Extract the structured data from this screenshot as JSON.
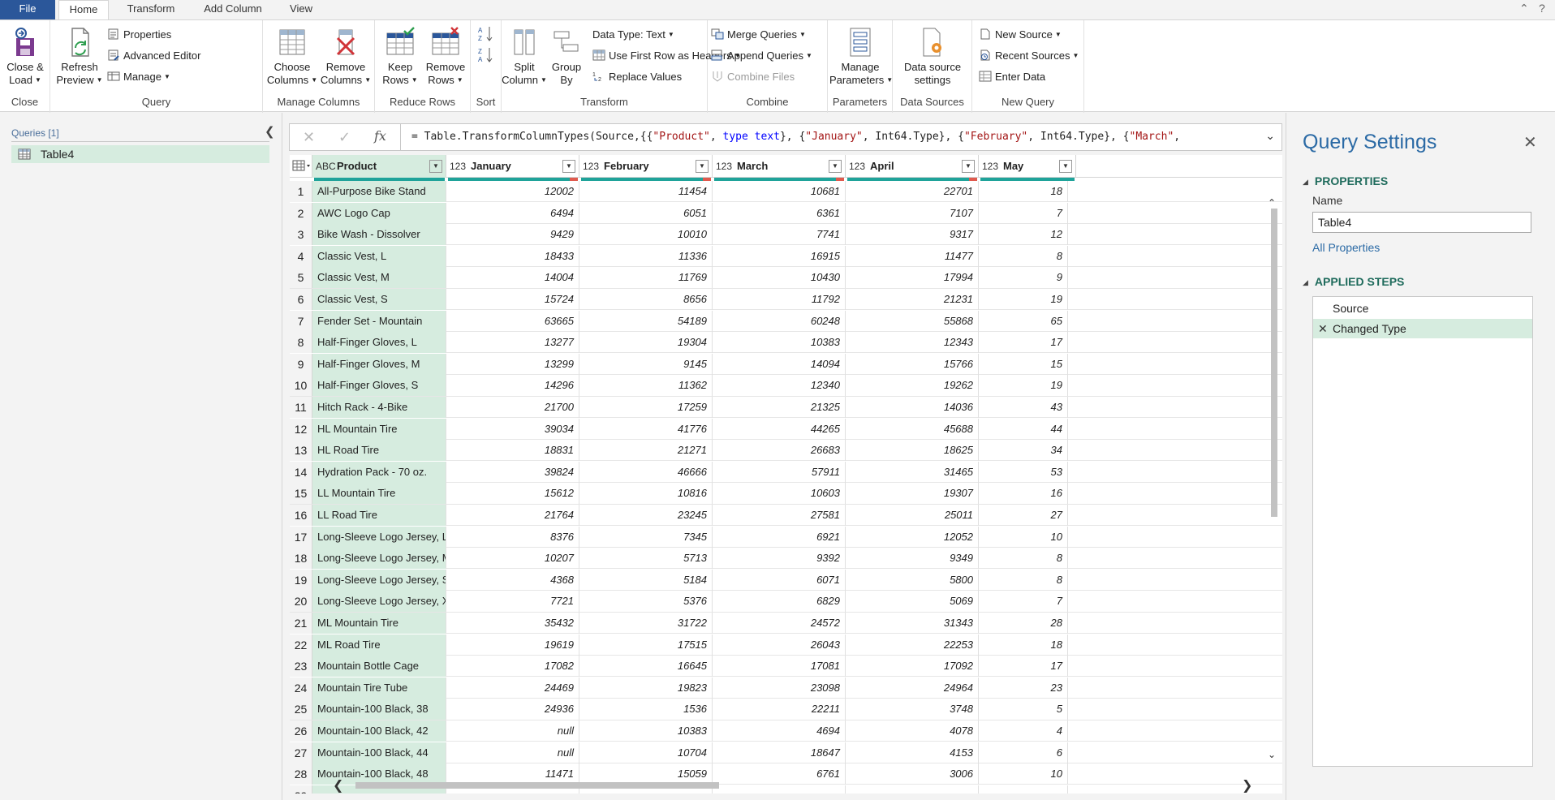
{
  "tabs": {
    "file": "File",
    "home": "Home",
    "transform": "Transform",
    "add_column": "Add Column",
    "view": "View"
  },
  "ribbon": {
    "close_load": [
      "Close &",
      "Load"
    ],
    "refresh": [
      "Refresh",
      "Preview"
    ],
    "properties": "Properties",
    "advanced_editor": "Advanced Editor",
    "manage": "Manage",
    "choose_columns": [
      "Choose",
      "Columns"
    ],
    "remove_columns": [
      "Remove",
      "Columns"
    ],
    "keep_rows": [
      "Keep",
      "Rows"
    ],
    "remove_rows": [
      "Remove",
      "Rows"
    ],
    "split_column": [
      "Split",
      "Column"
    ],
    "group_by": [
      "Group",
      "By"
    ],
    "data_type": "Data Type: Text",
    "use_first_row": "Use First Row as Headers",
    "replace_values": "Replace Values",
    "merge_queries": "Merge Queries",
    "append_queries": "Append Queries",
    "combine_files": "Combine Files",
    "manage_parameters": [
      "Manage",
      "Parameters"
    ],
    "data_source_settings": [
      "Data source",
      "settings"
    ],
    "new_source": "New Source",
    "recent_sources": "Recent Sources",
    "enter_data": "Enter Data",
    "groups": {
      "close": "Close",
      "query": "Query",
      "manage_columns": "Manage Columns",
      "reduce_rows": "Reduce Rows",
      "sort": "Sort",
      "transform": "Transform",
      "combine": "Combine",
      "parameters": "Parameters",
      "data_sources": "Data Sources",
      "new_query": "New Query"
    }
  },
  "queries": {
    "header": "Queries [1]",
    "items": [
      "Table4"
    ]
  },
  "formula": {
    "prefix": "= Table.TransformColumnTypes(Source,{{",
    "s1": "\"Product\"",
    "c1": ", ",
    "k1": "type text",
    "c2": "}, {",
    "s2": "\"January\"",
    "c3": ", Int64.Type}, {",
    "s3": "\"February\"",
    "c4": ", Int64.Type}, {",
    "s4": "\"March\"",
    "c5": ","
  },
  "grid": {
    "columns": [
      {
        "type": "ABC",
        "name": "Product"
      },
      {
        "type": "123",
        "name": "January"
      },
      {
        "type": "123",
        "name": "February"
      },
      {
        "type": "123",
        "name": "March"
      },
      {
        "type": "123",
        "name": "April"
      },
      {
        "type": "123",
        "name": "May"
      }
    ],
    "rows": [
      [
        "All-Purpose Bike Stand",
        "12002",
        "11454",
        "10681",
        "22701",
        "18"
      ],
      [
        "AWC Logo Cap",
        "6494",
        "6051",
        "6361",
        "7107",
        "7"
      ],
      [
        "Bike Wash - Dissolver",
        "9429",
        "10010",
        "7741",
        "9317",
        "12"
      ],
      [
        "Classic Vest, L",
        "18433",
        "11336",
        "16915",
        "11477",
        "8"
      ],
      [
        "Classic Vest, M",
        "14004",
        "11769",
        "10430",
        "17994",
        "9"
      ],
      [
        "Classic Vest, S",
        "15724",
        "8656",
        "11792",
        "21231",
        "19"
      ],
      [
        "Fender Set - Mountain",
        "63665",
        "54189",
        "60248",
        "55868",
        "65"
      ],
      [
        "Half-Finger Gloves, L",
        "13277",
        "19304",
        "10383",
        "12343",
        "17"
      ],
      [
        "Half-Finger Gloves, M",
        "13299",
        "9145",
        "14094",
        "15766",
        "15"
      ],
      [
        "Half-Finger Gloves, S",
        "14296",
        "11362",
        "12340",
        "19262",
        "19"
      ],
      [
        "Hitch Rack - 4-Bike",
        "21700",
        "17259",
        "21325",
        "14036",
        "43"
      ],
      [
        "HL Mountain Tire",
        "39034",
        "41776",
        "44265",
        "45688",
        "44"
      ],
      [
        "HL Road Tire",
        "18831",
        "21271",
        "26683",
        "18625",
        "34"
      ],
      [
        "Hydration Pack - 70 oz.",
        "39824",
        "46666",
        "57911",
        "31465",
        "53"
      ],
      [
        "LL Mountain Tire",
        "15612",
        "10816",
        "10603",
        "19307",
        "16"
      ],
      [
        "LL Road Tire",
        "21764",
        "23245",
        "27581",
        "25011",
        "27"
      ],
      [
        "Long-Sleeve Logo Jersey, L",
        "8376",
        "7345",
        "6921",
        "12052",
        "10"
      ],
      [
        "Long-Sleeve Logo Jersey, M",
        "10207",
        "5713",
        "9392",
        "9349",
        "8"
      ],
      [
        "Long-Sleeve Logo Jersey, S",
        "4368",
        "5184",
        "6071",
        "5800",
        "8"
      ],
      [
        "Long-Sleeve Logo Jersey, XL",
        "7721",
        "5376",
        "6829",
        "5069",
        "7"
      ],
      [
        "ML Mountain Tire",
        "35432",
        "31722",
        "24572",
        "31343",
        "28"
      ],
      [
        "ML Road Tire",
        "19619",
        "17515",
        "26043",
        "22253",
        "18"
      ],
      [
        "Mountain Bottle Cage",
        "17082",
        "16645",
        "17081",
        "17092",
        "17"
      ],
      [
        "Mountain Tire Tube",
        "24469",
        "19823",
        "23098",
        "24964",
        "23"
      ],
      [
        "Mountain-100 Black, 38",
        "24936",
        "1536",
        "22211",
        "3748",
        "5"
      ],
      [
        "Mountain-100 Black, 42",
        "null",
        "10383",
        "4694",
        "4078",
        "4"
      ],
      [
        "Mountain-100 Black, 44",
        "null",
        "10704",
        "18647",
        "4153",
        "6"
      ],
      [
        "Mountain-100 Black, 48",
        "11471",
        "15059",
        "6761",
        "3006",
        "10"
      ],
      [
        "",
        "",
        "",
        "",
        "",
        ""
      ]
    ]
  },
  "settings": {
    "title": "Query Settings",
    "properties_header": "PROPERTIES",
    "name_label": "Name",
    "name_value": "Table4",
    "all_properties": "All Properties",
    "applied_steps_header": "APPLIED STEPS",
    "steps": [
      "Source",
      "Changed Type"
    ]
  },
  "colors": {
    "accent": "#2b579a",
    "selected": "#d6ecdf",
    "quality": "#1fa39a",
    "title": "#2b6aa5",
    "section": "#1f6b5c"
  }
}
